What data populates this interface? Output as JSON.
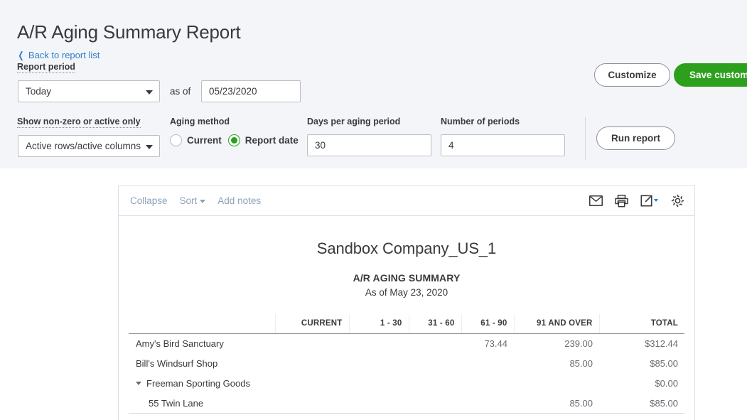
{
  "page": {
    "title": "A/R Aging Summary Report",
    "back_link": "Back to report list",
    "back_chevron": "chevron-left-icon"
  },
  "filters": {
    "report_period_label": "Report period",
    "report_period_value": "Today",
    "as_of_label": "as of",
    "as_of_value": "05/23/2020",
    "show_nonzero_label": "Show non-zero or active only",
    "show_nonzero_value": "Active rows/active columns",
    "aging_method_label": "Aging method",
    "aging_options": [
      {
        "label": "Current",
        "selected": false
      },
      {
        "label": "Report date",
        "selected": true
      }
    ],
    "days_per_period_label": "Days per aging period",
    "days_per_period_value": "30",
    "number_of_periods_label": "Number of periods",
    "number_of_periods_value": "4"
  },
  "actions": {
    "customize": "Customize",
    "save_customization": "Save custom",
    "run_report": "Run report"
  },
  "report_toolbar": {
    "collapse": "Collapse",
    "sort": "Sort",
    "add_notes": "Add notes",
    "icons": [
      "email-icon",
      "print-icon",
      "export-icon",
      "settings-gear-icon"
    ]
  },
  "report": {
    "company": "Sandbox Company_US_1",
    "title": "A/R AGING SUMMARY",
    "subtitle": "As of May 23, 2020",
    "columns": [
      "",
      "CURRENT",
      "1 - 30",
      "31 - 60",
      "61 - 90",
      "91 AND OVER",
      "TOTAL"
    ],
    "rows": [
      {
        "name": "Amy's Bird Sanctuary",
        "indent": 0,
        "group": false,
        "current": "",
        "d1_30": "",
        "d31_60": "",
        "d61_90": "73.44",
        "d91_over": "239.00",
        "total": "$312.44"
      },
      {
        "name": "Bill's Windsurf Shop",
        "indent": 0,
        "group": false,
        "current": "",
        "d1_30": "",
        "d31_60": "",
        "d61_90": "",
        "d91_over": "85.00",
        "total": "$85.00"
      },
      {
        "name": "Freeman Sporting Goods",
        "indent": 0,
        "group": true,
        "current": "",
        "d1_30": "",
        "d31_60": "",
        "d61_90": "",
        "d91_over": "",
        "total": "$0.00"
      },
      {
        "name": "55 Twin Lane",
        "indent": 1,
        "group": false,
        "current": "",
        "d1_30": "",
        "d31_60": "",
        "d61_90": "",
        "d91_over": "85.00",
        "total": "$85.00"
      }
    ]
  },
  "colors": {
    "brand_green": "#2ca01c",
    "link_blue": "#2b7ec9",
    "header_bg": "#f4f5f8",
    "text_dark": "#393a3d",
    "toolbar_link": "#8ca2ba"
  }
}
